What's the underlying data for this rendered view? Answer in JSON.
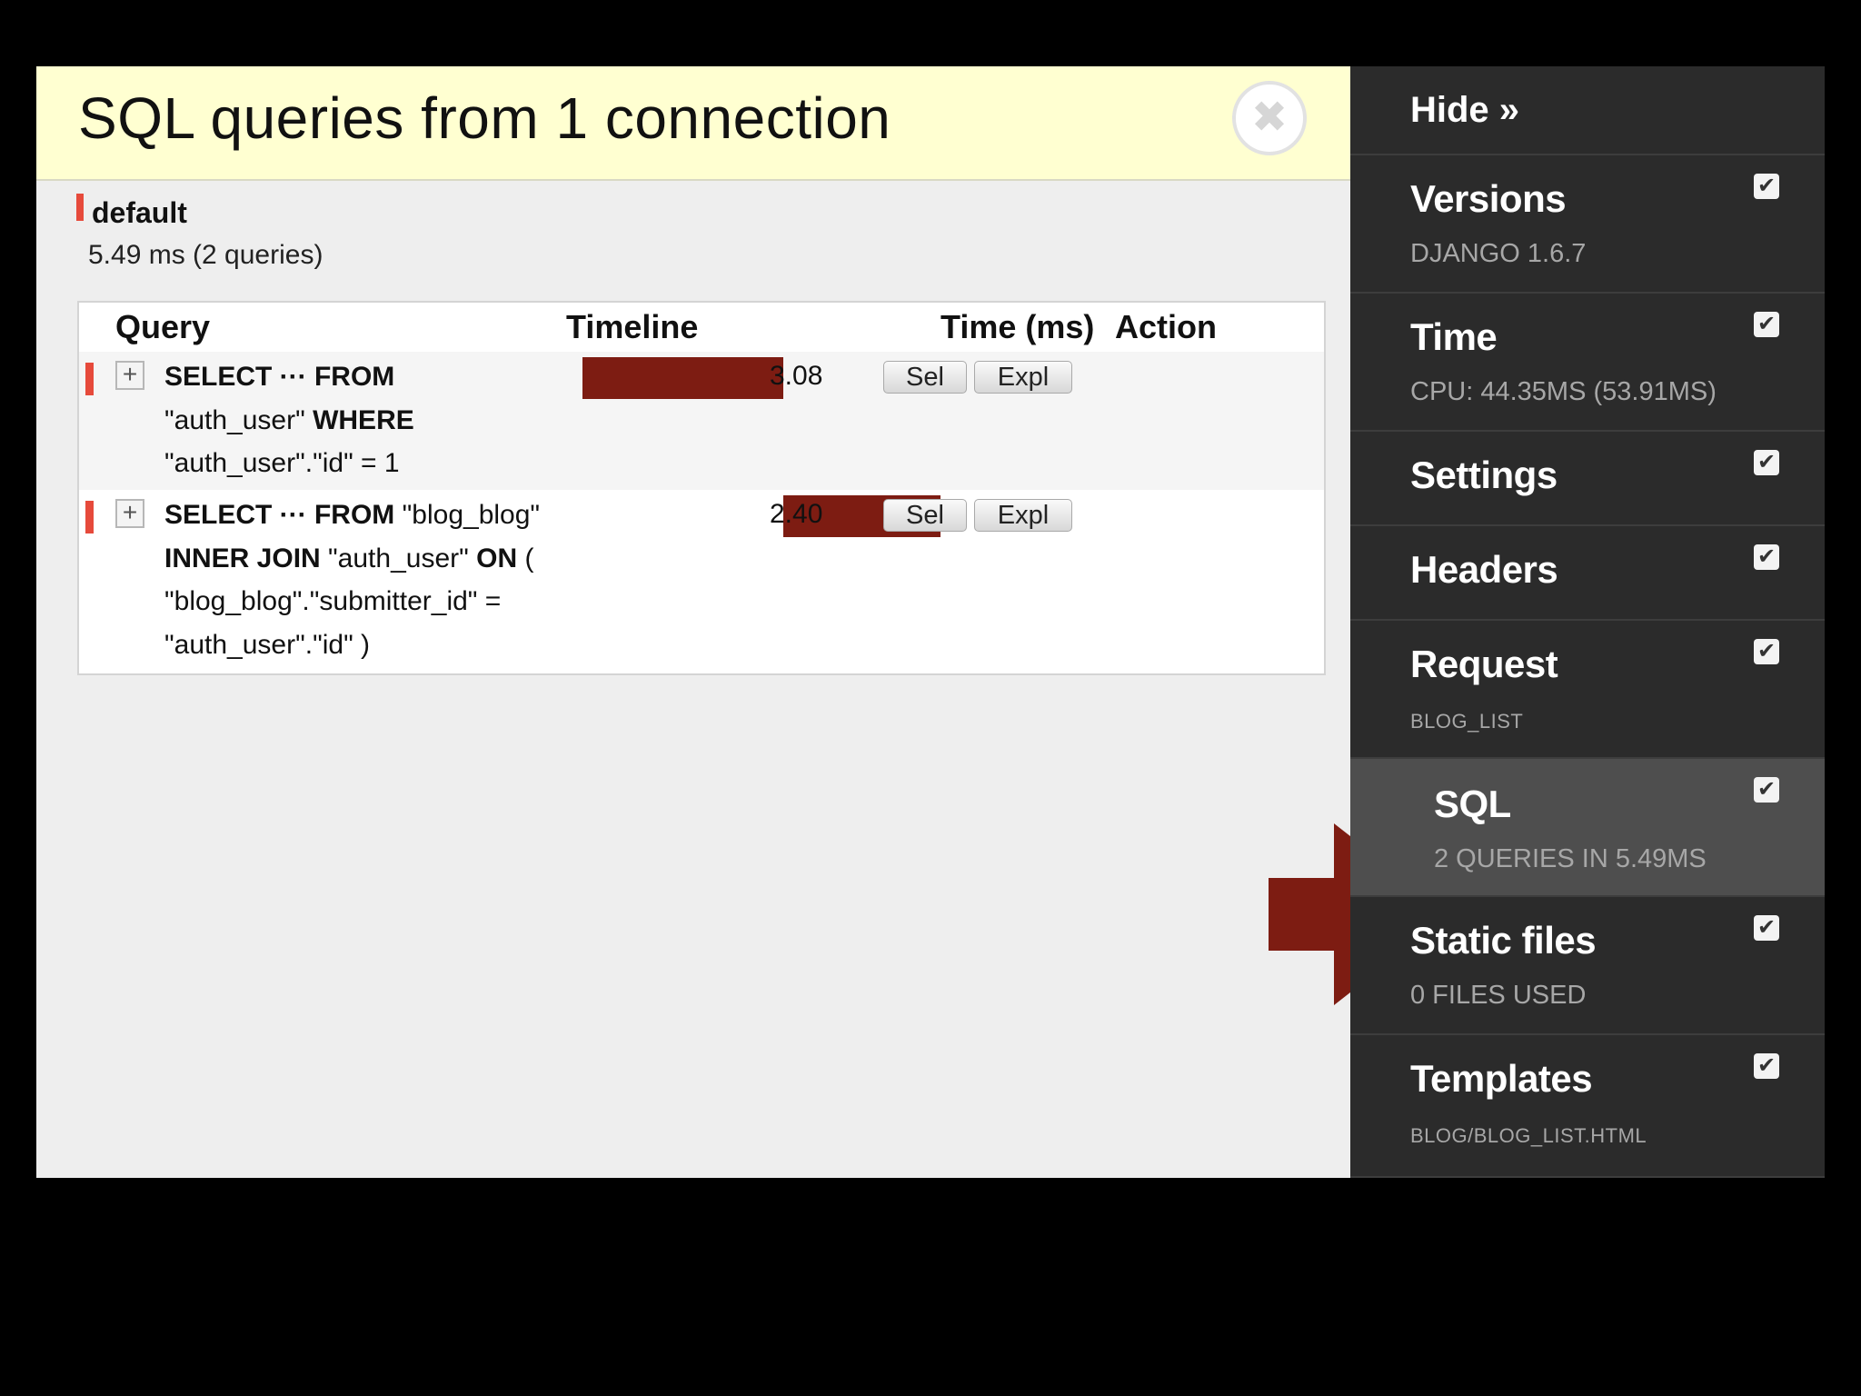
{
  "panel": {
    "title": "SQL queries from 1 connection",
    "close_glyph": "✖",
    "connection_name": "default",
    "connection_summary": "5.49 ms (2 queries)"
  },
  "table": {
    "headers": {
      "query": "Query",
      "timeline": "Timeline",
      "time": "Time (ms)",
      "action": "Action"
    },
    "rows": [
      {
        "sql_lines": [
          [
            {
              "kw": true,
              "t": "SELECT ··· FROM"
            }
          ],
          [
            {
              "kw": false,
              "t": "\"auth_user\" "
            },
            {
              "kw": true,
              "t": "WHERE"
            }
          ],
          [
            {
              "kw": false,
              "t": "\"auth_user\".\"id\" = 1"
            }
          ]
        ],
        "timeline_fraction": {
          "start": 0.0,
          "end": 0.562
        },
        "time": "3.08",
        "sel_label": "Sel",
        "expl_label": "Expl"
      },
      {
        "sql_lines": [
          [
            {
              "kw": true,
              "t": "SELECT ··· FROM "
            },
            {
              "kw": false,
              "t": "\"blog_blog\""
            }
          ],
          [
            {
              "kw": true,
              "t": "INNER JOIN "
            },
            {
              "kw": false,
              "t": "\"auth_user\" "
            },
            {
              "kw": true,
              "t": "ON "
            },
            {
              "kw": false,
              "t": "("
            }
          ],
          [
            {
              "kw": false,
              "t": "\"blog_blog\".\"submitter_id\" ="
            }
          ],
          [
            {
              "kw": false,
              "t": "\"auth_user\".\"id\" )"
            }
          ]
        ],
        "timeline_fraction": {
          "start": 0.562,
          "end": 1.0
        },
        "time": "2.40",
        "sel_label": "Sel",
        "expl_label": "Expl"
      }
    ]
  },
  "toolbar": {
    "hide_label": "Hide »",
    "check_glyph": "✔",
    "items": [
      {
        "title": "Versions",
        "subtitle": "DJANGO 1.6.7",
        "active": false
      },
      {
        "title": "Time",
        "subtitle": "CPU: 44.35MS (53.91MS)",
        "active": false
      },
      {
        "title": "Settings",
        "subtitle": "",
        "active": false
      },
      {
        "title": "Headers",
        "subtitle": "",
        "active": false
      },
      {
        "title": "Request",
        "subtitle": "BLOG_LIST",
        "active": false
      },
      {
        "title": "SQL",
        "subtitle": "2 QUERIES IN 5.49MS",
        "active": true
      },
      {
        "title": "Static files",
        "subtitle": "0 FILES USED",
        "active": false
      },
      {
        "title": "Templates",
        "subtitle": "BLOG/BLOG_LIST.HTML",
        "active": false
      }
    ]
  },
  "colors": {
    "header_bg": "#ffffd1",
    "timeline_bar": "#7d1c12",
    "marker": "#e64a3b",
    "arrow": "#7d1c12",
    "toolbar_bg": "#2b2b2b",
    "toolbar_active_bg": "#4e4e4e"
  }
}
